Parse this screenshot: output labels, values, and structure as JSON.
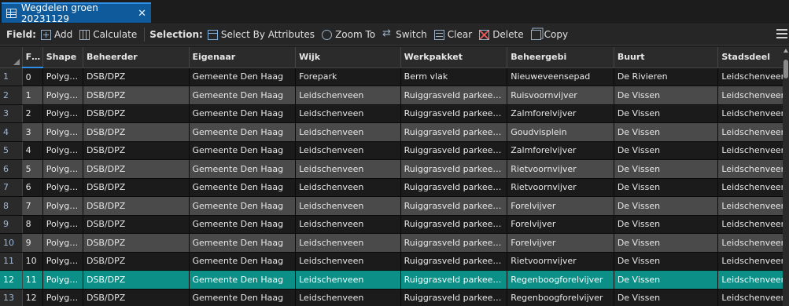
{
  "tab": {
    "title": "Wegdelen groen 20231129",
    "close_glyph": "✕"
  },
  "toolbar": {
    "field_label": "Field:",
    "add_label": "Add",
    "calculate_label": "Calculate",
    "selection_label": "Selection:",
    "select_by_attributes_label": "Select By Attributes",
    "zoom_to_label": "Zoom To",
    "switch_label": "Switch",
    "clear_label": "Clear",
    "delete_label": "Delete",
    "copy_label": "Copy"
  },
  "table": {
    "columns": [
      "FID",
      "Shape",
      "Beheerder",
      "Eigenaar",
      "Wijk",
      "Werkpakket",
      "Beheergebi",
      "Buurt",
      "Stadsdeel"
    ],
    "selected_row": 12,
    "rows": [
      {
        "n": "1",
        "cells": [
          "0",
          "Polygon",
          "DSB/DPZ",
          "Gemeente Den Haag",
          "Forepark",
          "Berm vlak",
          "Nieuweveensepad",
          "De Rivieren",
          "Leidschenveen-"
        ]
      },
      {
        "n": "2",
        "cells": [
          "1",
          "Polygon",
          "DSB/DPZ",
          "Gemeente Den Haag",
          "Leidschenveen",
          "Ruiggrasveld parkeert...",
          "Ruisvoornvijver",
          "De Vissen",
          "Leidschenveen-"
        ]
      },
      {
        "n": "3",
        "cells": [
          "2",
          "Polygon",
          "DSB/DPZ",
          "Gemeente Den Haag",
          "Leidschenveen",
          "Ruiggrasveld parkeert...",
          "Zalmforelvijver",
          "De Vissen",
          "Leidschenveen-"
        ]
      },
      {
        "n": "4",
        "cells": [
          "3",
          "Polygon",
          "DSB/DPZ",
          "Gemeente Den Haag",
          "Leidschenveen",
          "Ruiggrasveld parkeert...",
          "Goudvisplein",
          "De Vissen",
          "Leidschenveen-"
        ]
      },
      {
        "n": "5",
        "cells": [
          "4",
          "Polygon",
          "DSB/DPZ",
          "Gemeente Den Haag",
          "Leidschenveen",
          "Ruiggrasveld parkeert...",
          "Zalmforelvijver",
          "De Vissen",
          "Leidschenveen-"
        ]
      },
      {
        "n": "6",
        "cells": [
          "5",
          "Polygon",
          "DSB/DPZ",
          "Gemeente Den Haag",
          "Leidschenveen",
          "Ruiggrasveld parkeert...",
          "Rietvoornvijver",
          "De Vissen",
          "Leidschenveen-"
        ]
      },
      {
        "n": "7",
        "cells": [
          "6",
          "Polygon",
          "DSB/DPZ",
          "Gemeente Den Haag",
          "Leidschenveen",
          "Ruiggrasveld parkeert...",
          "Rietvoornvijver",
          "De Vissen",
          "Leidschenveen-"
        ]
      },
      {
        "n": "8",
        "cells": [
          "7",
          "Polygon",
          "DSB/DPZ",
          "Gemeente Den Haag",
          "Leidschenveen",
          "Ruiggrasveld parkeert...",
          "Forelvijver",
          "De Vissen",
          "Leidschenveen-"
        ]
      },
      {
        "n": "9",
        "cells": [
          "8",
          "Polygon",
          "DSB/DPZ",
          "Gemeente Den Haag",
          "Leidschenveen",
          "Ruiggrasveld parkeert...",
          "Forelvijver",
          "De Vissen",
          "Leidschenveen-"
        ]
      },
      {
        "n": "10",
        "cells": [
          "9",
          "Polygon",
          "DSB/DPZ",
          "Gemeente Den Haag",
          "Leidschenveen",
          "Ruiggrasveld parkeert...",
          "Forelvijver",
          "De Vissen",
          "Leidschenveen-"
        ]
      },
      {
        "n": "11",
        "cells": [
          "10",
          "Polygon",
          "DSB/DPZ",
          "Gemeente Den Haag",
          "Leidschenveen",
          "Ruiggrasveld parkeert...",
          "Rietvoornvijver",
          "De Vissen",
          "Leidschenveen-"
        ]
      },
      {
        "n": "12",
        "cells": [
          "11",
          "Polygon",
          "DSB/DPZ",
          "Gemeente Den Haag",
          "Leidschenveen",
          "Ruiggrasveld parkeert...",
          "Regenboogforelvijver",
          "De Vissen",
          "Leidschenveen-"
        ]
      },
      {
        "n": "13",
        "cells": [
          "12",
          "Polygon",
          "DSB/DPZ",
          "Gemeente Den Haag",
          "Leidschenveen",
          "Ruiggrasveld parkeert...",
          "Regenboogforelvijver",
          "De Vissen",
          "Leidschenveen-"
        ]
      }
    ]
  },
  "icons": [
    "table-icon",
    "add-field-icon",
    "calculate-icon",
    "select-by-attributes-icon",
    "zoom-to-icon",
    "switch-icon",
    "clear-icon",
    "delete-icon",
    "copy-icon",
    "menu-icon"
  ],
  "colors": {
    "tab_active": "#0f5a9a",
    "selected_row": "#0b8f87",
    "row_alt": "#4a4a4a",
    "row_base": "#1b1b1b"
  }
}
